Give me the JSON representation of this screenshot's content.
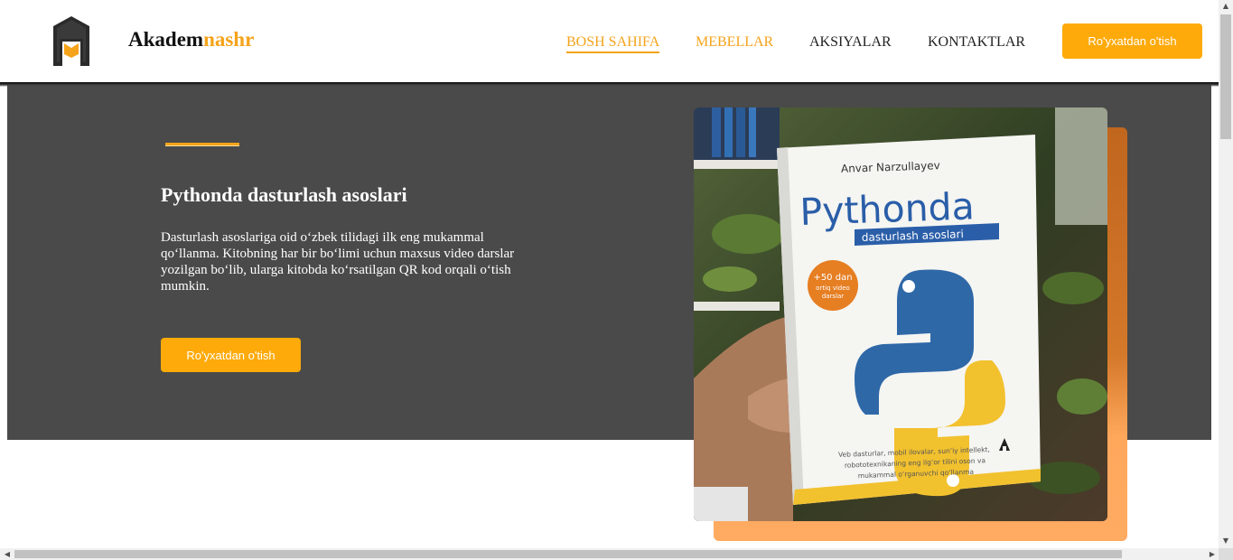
{
  "header": {
    "brand_part1": "Akadem",
    "brand_part2": "nashr",
    "logo_icon": "book-logo-icon",
    "nav": [
      {
        "label": "BOSH SAHIFA",
        "state": "active"
      },
      {
        "label": "MEBELLAR",
        "state": "accent"
      },
      {
        "label": "AKSIYALAR",
        "state": "normal"
      },
      {
        "label": "KONTAKTLAR",
        "state": "normal"
      }
    ],
    "register_button": "Ro'yxatdan o'tish"
  },
  "hero": {
    "title": "Pythonda dasturlash asoslari",
    "text": "Dasturlash asoslariga oid o‘zbek tilidagi ilk eng mukammal qo‘llanma. Kitobning har bir bo‘limi uchun maxsus video darslar yozilgan bo‘lib, ularga kitobda ko‘rsatilgan QR kod orqali o‘tish mumkin.",
    "button": "Ro'yxatdan o'tish"
  },
  "book_image": {
    "author": "Anvar Narzullayev",
    "title": "Pythonda",
    "subtitle": "dasturlash asoslari",
    "badge": [
      "+50 dan",
      "ortiq video",
      "darslar"
    ],
    "blurb": [
      "Veb dasturlar, mobil ilovalar, sun’iy intellekt,",
      "robototexnikaning eng ilg‘or tilini oson va",
      "mukammal o‘rganuvchi qo‘llanma"
    ]
  },
  "colors": {
    "accent": "#f5a31a",
    "button": "#fdaa0a",
    "hero_bg": "#4a4a4a"
  }
}
